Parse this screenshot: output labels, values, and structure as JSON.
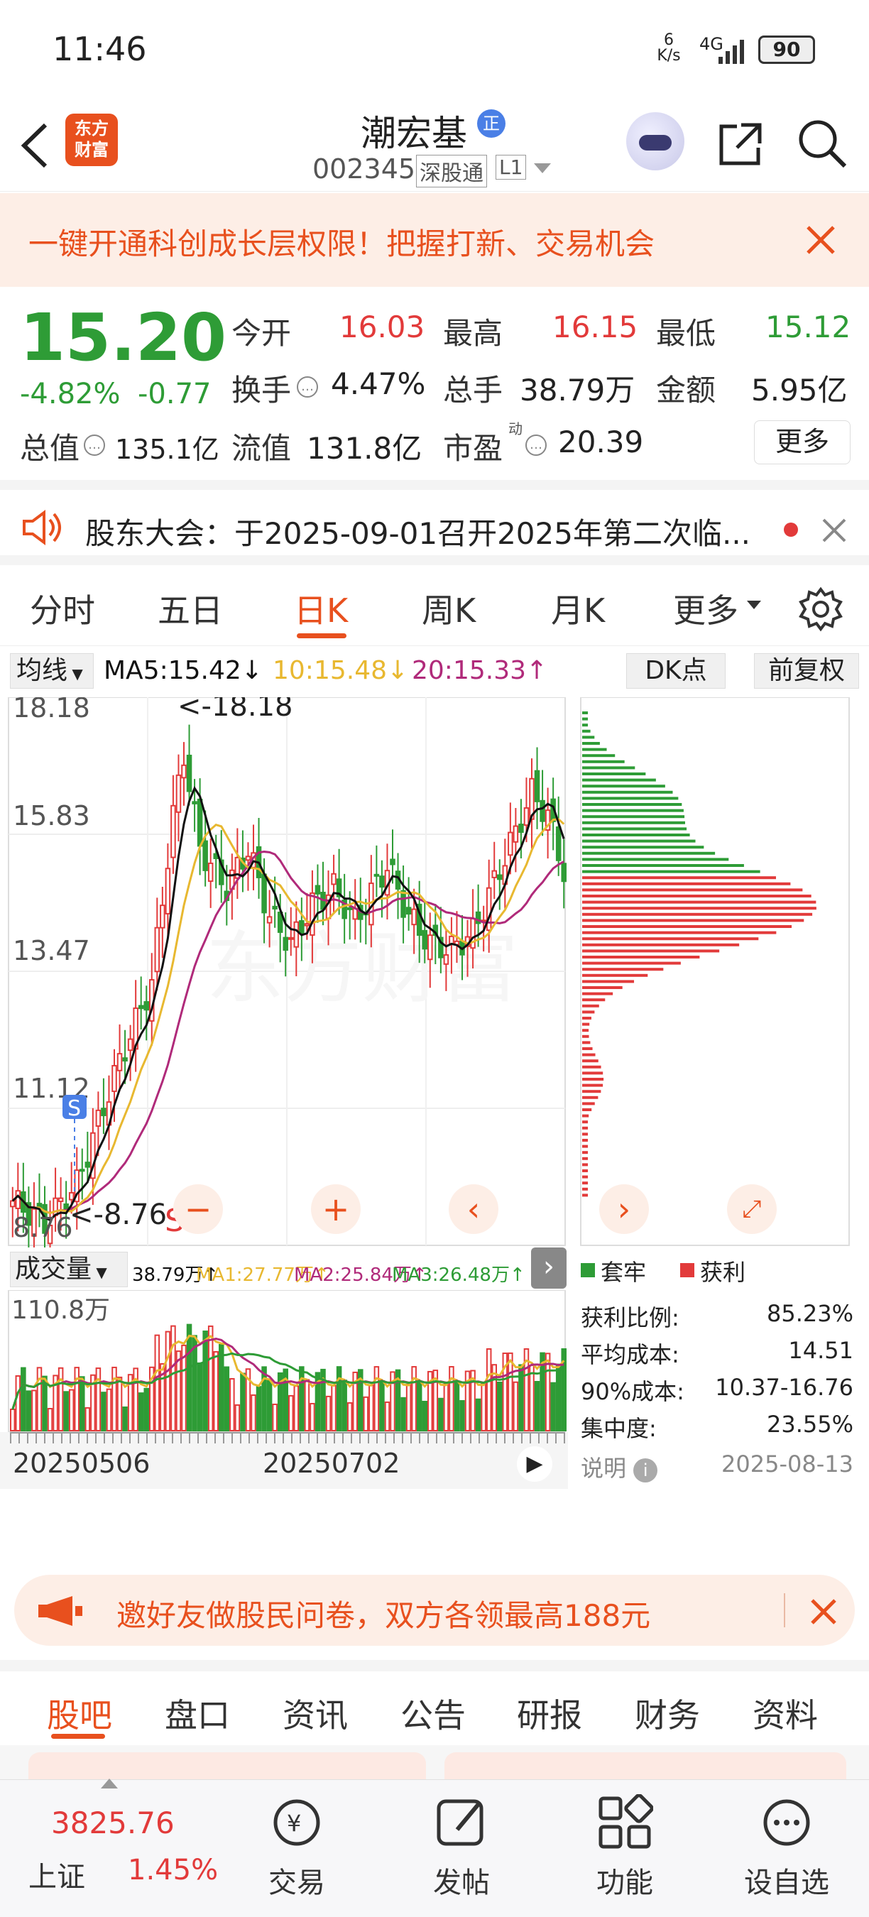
{
  "status": {
    "time": "11:46",
    "net_speed_top": "6",
    "net_speed_bottom": "K/s",
    "signal": "4G",
    "battery": "90"
  },
  "nav": {
    "brand_line1": "东方",
    "brand_line2": "财富",
    "stock_name": "潮宏基",
    "stock_badge": "正",
    "stock_code": "002345",
    "exchange_tag": "深股通",
    "level_tag": "L1"
  },
  "banner": {
    "text": "一键开通科创成长层权限！把握打新、交易机会"
  },
  "quote": {
    "price": "15.20",
    "change_pct": "-4.82%",
    "change_amt": "-0.77",
    "open_label": "今开",
    "open": "16.03",
    "high_label": "最高",
    "high": "16.15",
    "low_label": "最低",
    "low": "15.12",
    "turnover_label": "换手",
    "turnover": "4.47%",
    "volume_label": "总手",
    "volume": "38.79万",
    "amount_label": "金额",
    "amount": "5.95亿",
    "mktcap_label": "总值",
    "mktcap": "135.1亿",
    "float_label": "流值",
    "float_cap": "131.8亿",
    "pe_label": "市盈",
    "pe_sup": "动",
    "pe": "20.39",
    "more_label": "更多"
  },
  "notice": {
    "text": "股东大会：于2025-09-01召开2025年第二次临..."
  },
  "tabs": {
    "items": [
      "分时",
      "五日",
      "日K",
      "周K",
      "月K",
      "更多"
    ],
    "active_index": 2
  },
  "ma_bar": {
    "selector": "均线",
    "ma5": "MA5:15.42↓",
    "ma10": "10:15.48↓",
    "ma20": "20:15.33↑",
    "dk": "DK点",
    "adjust": "前复权"
  },
  "kchart": {
    "y_labels": [
      "18.18",
      "15.83",
      "13.47",
      "11.12",
      "8.76"
    ],
    "max_label": "<-18.18",
    "min_label": "<-8.76",
    "s_mark": "S",
    "s_box": "S"
  },
  "chip_legend": {
    "trapped": "套牢",
    "profit": "获利"
  },
  "chip_stats": {
    "rows": [
      {
        "label": "获利比例:",
        "value": "85.23%"
      },
      {
        "label": "平均成本:",
        "value": "14.51"
      },
      {
        "label": "90%成本:",
        "value": "10.37-16.76"
      },
      {
        "label": "集中度:",
        "value": "23.55%"
      }
    ],
    "note_label": "说明",
    "date": "2025-08-13"
  },
  "vol_bar": {
    "selector": "成交量",
    "vol": "38.79万↑",
    "ma1": "MA1:27.77万↑",
    "ma2": "MA2:25.84万↑",
    "ma3": "MA3:26.48万↑",
    "max_label": "110.8万"
  },
  "vol_dates": {
    "d1": "20250506",
    "d2": "20250702"
  },
  "survey": {
    "text": "邀好友做股民问卷，双方各领最高188元"
  },
  "news_tabs": {
    "items": [
      "股吧",
      "盘口",
      "资讯",
      "公告",
      "研报",
      "财务",
      "资料"
    ],
    "active_index": 0
  },
  "bottom": {
    "index_value": "3825.76",
    "index_name": "上证",
    "index_pct": "1.45%",
    "trade": "交易",
    "post": "发帖",
    "func": "功能",
    "watch": "设自选"
  },
  "colors": {
    "accent": "#e8501e",
    "up": "#e23a3a",
    "down": "#2e9c36",
    "ma5": "#111111",
    "ma10": "#e8b830",
    "ma20": "#b02a7a"
  },
  "chart_data": {
    "type": "candlestick",
    "y_range": [
      8.76,
      18.18
    ],
    "x_labels": [
      "20250506",
      "20250702"
    ],
    "max_price": 18.18,
    "min_price": 8.76,
    "last_close": 15.2,
    "chip_distribution": {
      "profit_ratio": 85.23,
      "avg_cost": 14.51,
      "cost_90": "10.37-16.76",
      "concentration": 23.55,
      "date": "2025-08-13"
    }
  }
}
